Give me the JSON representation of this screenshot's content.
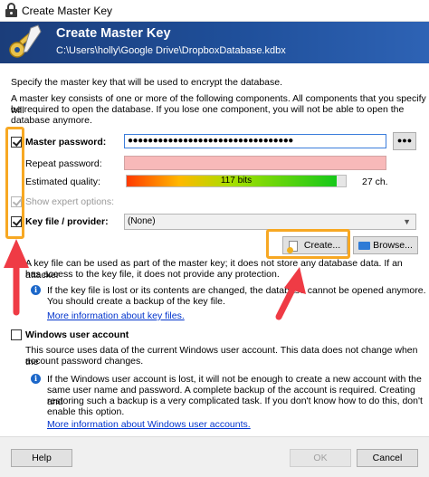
{
  "window": {
    "title": "Create Master Key"
  },
  "header": {
    "title": "Create Master Key",
    "path": "C:\\Users\\holly\\Google Drive\\DropboxDatabase.kdbx"
  },
  "intro": "Specify the master key that will be used to encrypt the database.",
  "description": [
    "A master key consists of one or more of the following components. All components that you specify will",
    "be required to open the database. If you lose one component, you will not be able to open the",
    "database anymore."
  ],
  "master_password": {
    "label": "Master password:",
    "checked": true,
    "value": "●●●●●●●●●●●●●●●●●●●●●●●●●●●●●●●●●",
    "toggle_label": "●●●",
    "repeat_label": "Repeat password:",
    "repeat_value": "",
    "quality_label": "Estimated quality:",
    "quality_bits": "117 bits",
    "quality_fraction": 0.96,
    "char_count": "27 ch."
  },
  "expert_options": {
    "label": "Show expert options:",
    "checked": true
  },
  "key_file": {
    "label": "Key file / provider:",
    "checked": true,
    "selected": "(None)",
    "create_label": "Create...",
    "browse_label": "Browse...",
    "info": [
      "A key file can be used as part of the master key; it does not store any database data. If an attacker",
      "has access to the key file, it does not provide any protection."
    ],
    "warning": [
      "If the key file is lost or its contents are changed, the database cannot be opened anymore.",
      "You should create a backup of the key file."
    ],
    "more_link": "More information about key files."
  },
  "windows_account": {
    "label": "Windows user account",
    "checked": false,
    "info": [
      "This source uses data of the current Windows user account. This data does not change when the",
      "account password changes."
    ],
    "warning": [
      "If the Windows user account is lost, it will not be enough to create a new account with the",
      "same user name and password. A complete backup of the account is required. Creating and",
      "restoring such a backup is a very complicated task. If you don't know how to do this, don't",
      "enable this option."
    ],
    "more_link": "More information about Windows user accounts."
  },
  "footer": {
    "help_label": "Help",
    "ok_label": "OK",
    "cancel_label": "Cancel"
  },
  "colors": {
    "annotation_highlight": "#f7a823",
    "annotation_arrow": "#ef3b45",
    "banner": "#1f4f9a",
    "link": "#0033cc"
  }
}
